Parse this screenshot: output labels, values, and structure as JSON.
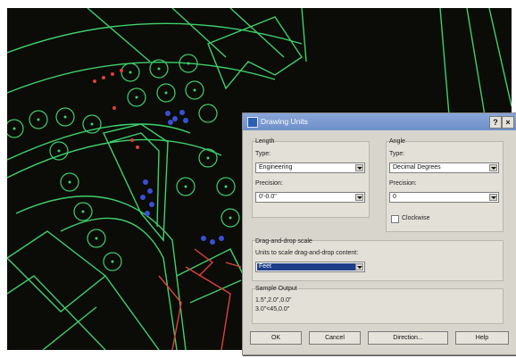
{
  "dialog": {
    "title": "Drawing Units",
    "help_btn": "?",
    "close_btn": "×",
    "length": {
      "group_label": "Length",
      "type_label": "Type:",
      "type_value": "Engineering",
      "precision_label": "Precision:",
      "precision_value": "0'-0.0\""
    },
    "angle": {
      "group_label": "Angle",
      "type_label": "Type:",
      "type_value": "Decimal Degrees",
      "precision_label": "Precision:",
      "precision_value": "0",
      "clockwise_label": "Clockwise"
    },
    "scale": {
      "group_label": "Drag-and-drop scale",
      "desc": "Units to scale drag-and-drop content:",
      "value": "Feet"
    },
    "sample": {
      "group_label": "Sample Output",
      "line1": "1.5\",2.0\",0.0\"",
      "line2": "3.0\"<45,0.0\""
    },
    "buttons": {
      "ok": "OK",
      "cancel": "Cancel",
      "direction": "Direction...",
      "help": "Help"
    }
  },
  "colors": {
    "cad_background": "#0b0b07",
    "lines": "#3fd06a",
    "trees_blue": "#3b4fd6",
    "red": "#e0403a",
    "title_bar": "#7a98d2"
  }
}
